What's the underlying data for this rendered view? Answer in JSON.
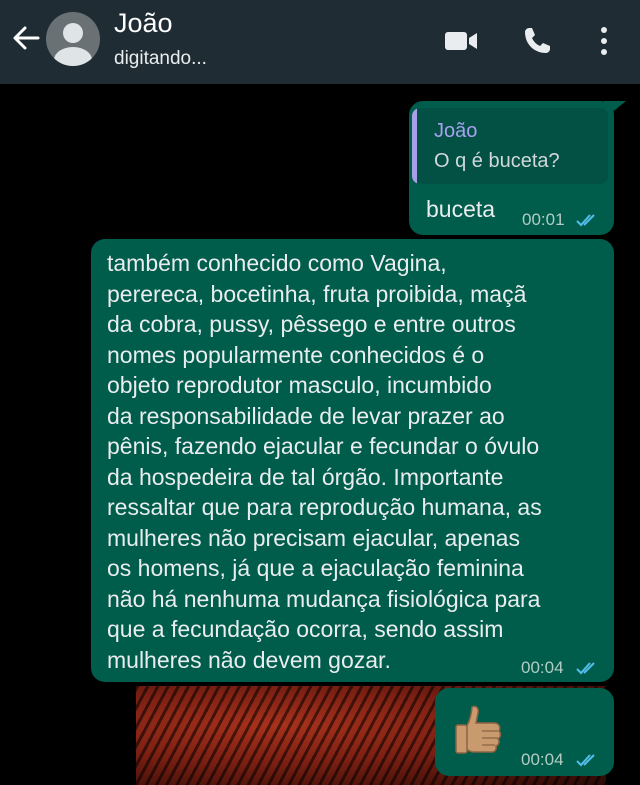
{
  "header": {
    "contact_name": "João",
    "status": "digitando..."
  },
  "messages": [
    {
      "quote_author": "João",
      "quote_text": "O q é buceta?",
      "text": "buceta",
      "time": "00:01",
      "ticks": "read-double-check-icon"
    },
    {
      "text": "também conhecido como Vagina,\nperereca, bocetinha, fruta proibida, maçã\nda cobra, pussy, pêssego e entre outros\nnomes popularmente conhecidos é o\nobjeto reprodutor masculo, incumbido\nda responsabilidade de levar prazer ao\npênis, fazendo ejacular e fecundar o óvulo\nda hospedeira de tal órgão. Importante\nressaltar que para reprodução humana, as\nmulheres não precisam ejacular, apenas\nos homens, já que a ejaculação feminina\nnão há nenhuma mudança fisiológica para\nque a fecundação ocorra, sendo assim\nmulheres não devem gozar.",
      "time": "00:04",
      "ticks": "read-double-check-icon"
    },
    {
      "sticker": "thumbs-up-icon",
      "time": "00:04",
      "ticks": "read-double-check-icon"
    }
  ],
  "colors": {
    "header_bg": "#1f2c34",
    "outgoing_bubble": "#005c4b",
    "quote_accent": "#a79fe8",
    "read_ticks": "#53bdeb",
    "chat_bg": "#000000"
  }
}
